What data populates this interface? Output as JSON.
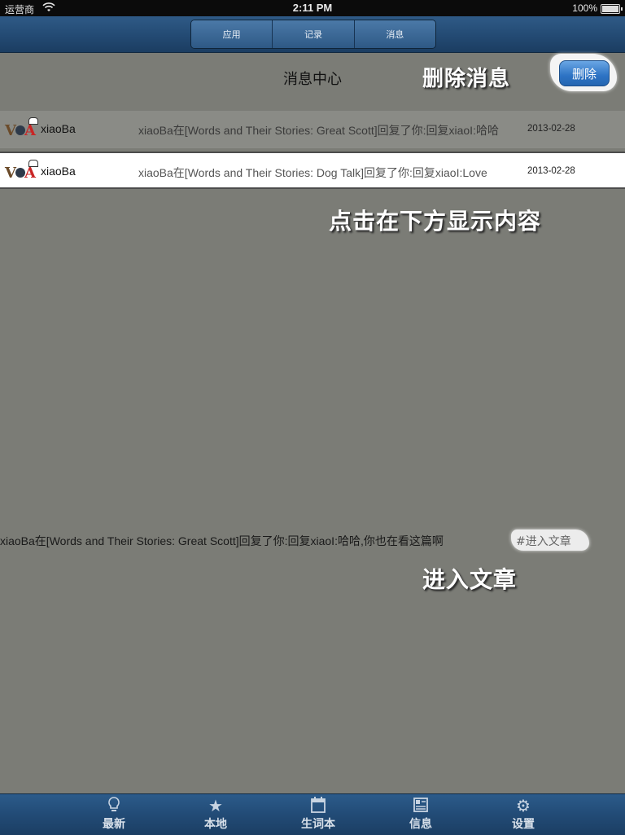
{
  "status_bar": {
    "carrier": "运营商",
    "time": "2:11 PM",
    "battery": "100%"
  },
  "top_tabs": [
    "应用",
    "记录",
    "消息"
  ],
  "header": {
    "title": "消息中心",
    "delete_label": "删除"
  },
  "annotations": {
    "delete_message": "删除消息",
    "click_show": "点击在下方显示内容",
    "enter_article": "进入文章"
  },
  "messages": [
    {
      "user": "xiaoBa",
      "text": "xiaoBa在[Words and Their Stories: Great Scott]回复了你:回复xiaoI:哈哈",
      "date": "2013-02-28"
    },
    {
      "user": "xiaoBa",
      "text": "xiaoBa在[Words and Their Stories: Dog Talk]回复了你:回复xiaoI:Love",
      "date": "2013-02-28"
    }
  ],
  "content": {
    "text": "xiaoBa在[Words and Their Stories: Great Scott]回复了你:回复xiaoI:哈哈,你也在看这篇啊",
    "link": "#进入文章"
  },
  "bottom_tabs": [
    {
      "icon": "lightbulb-icon",
      "label": "最新"
    },
    {
      "icon": "star-icon",
      "label": "本地"
    },
    {
      "icon": "calendar-icon",
      "label": "生词本"
    },
    {
      "icon": "grid-icon",
      "label": "信息"
    },
    {
      "icon": "gear-icon",
      "label": "设置"
    }
  ],
  "colors": {
    "background": "#7b7c76",
    "nav": "#234a73",
    "delete_button": "#2d73c4"
  }
}
